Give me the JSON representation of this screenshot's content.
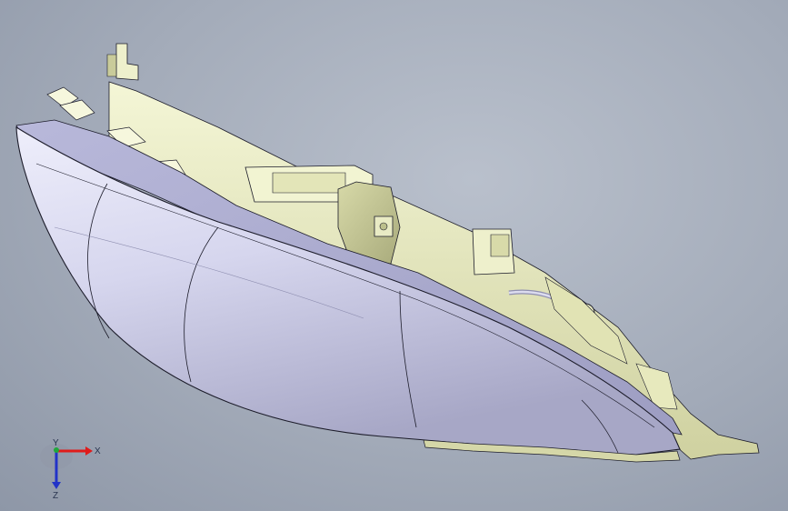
{
  "viewport": {
    "model": "headlamp-assembly",
    "colors": {
      "background": "#a3abb9",
      "lens": "#dcdcf0",
      "lens_shadow": "#a9a9c8",
      "housing": "#e9ebc4",
      "housing_shadow": "#b8b98a",
      "edge": "#1c1c2a"
    }
  },
  "triad": {
    "x_label": "X",
    "y_label": "Y",
    "z_label": "Z",
    "colors": {
      "x": "#e01b1b",
      "y": "#1fa83a",
      "z": "#2233c8"
    }
  }
}
